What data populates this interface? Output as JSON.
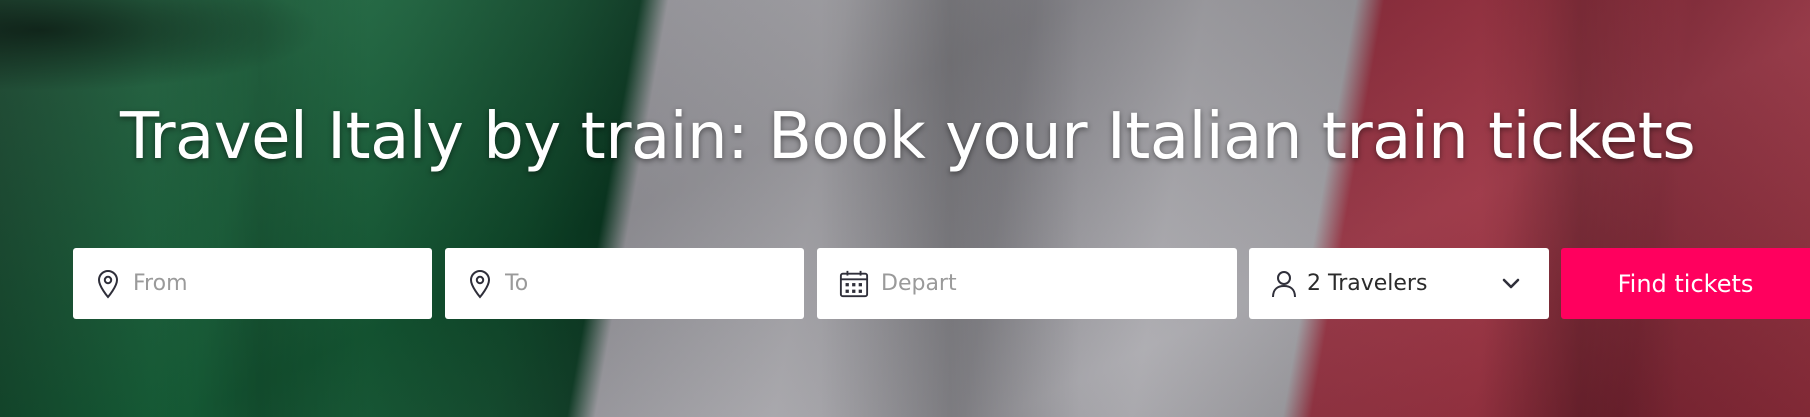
{
  "hero": {
    "title": "Travel Italy by train: Book your Italian train tickets",
    "flag_colors": {
      "green": "#196b3f",
      "white": "#aaa9ae",
      "red": "#9a2d3d"
    }
  },
  "search": {
    "from": {
      "placeholder": "From",
      "icon": "map-pin-icon"
    },
    "to": {
      "placeholder": "To",
      "icon": "map-pin-icon"
    },
    "depart": {
      "placeholder": "Depart",
      "icon": "calendar-icon"
    },
    "travelers": {
      "label": "2 Travelers",
      "icon": "person-icon",
      "dropdown_icon": "chevron-down-icon"
    },
    "submit": {
      "label": "Find tickets",
      "color": "#ff005e"
    }
  }
}
